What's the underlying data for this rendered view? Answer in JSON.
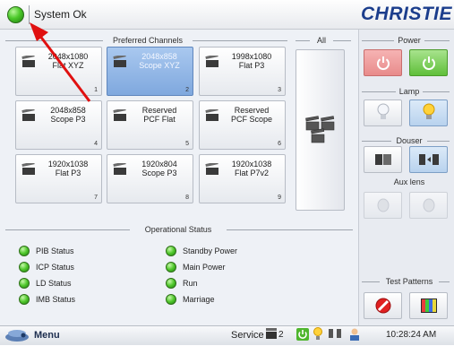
{
  "topbar": {
    "status_text": "System Ok",
    "brand": "CHRISTIE",
    "brand_color": "#1b3d8c"
  },
  "channels": {
    "title": "Preferred Channels",
    "all_title": "All",
    "tiles": [
      {
        "label": "2048x1080\nFlat XYZ",
        "num": "1",
        "selected": false
      },
      {
        "label": "2048x858\nScope XYZ",
        "num": "2",
        "selected": true
      },
      {
        "label": "1998x1080\nFlat P3",
        "num": "3",
        "selected": false
      },
      {
        "label": "2048x858\nScope P3",
        "num": "4",
        "selected": false
      },
      {
        "label": "Reserved\nPCF Flat",
        "num": "5",
        "selected": false
      },
      {
        "label": "Reserved\nPCF Scope",
        "num": "6",
        "selected": false
      },
      {
        "label": "1920x1038\nFlat P3",
        "num": "7",
        "selected": false
      },
      {
        "label": "1920x804\nScope P3",
        "num": "8",
        "selected": false
      },
      {
        "label": "1920x1038\nFlat P7v2",
        "num": "9",
        "selected": false
      }
    ]
  },
  "operational": {
    "title": "Operational Status",
    "items_left": [
      "PIB Status",
      "ICP Status",
      "LD Status",
      "IMB Status"
    ],
    "items_right": [
      "Standby Power",
      "Main Power",
      "Run",
      "Marriage"
    ]
  },
  "right": {
    "power_title": "Power",
    "lamp_title": "Lamp",
    "douser_title": "Douser",
    "aux_title": "Aux lens",
    "test_title": "Test Patterns"
  },
  "bottombar": {
    "menu_label": "Menu",
    "service_label": "Service",
    "channel_count": "2",
    "clock": "10:28:24 AM"
  },
  "colors": {
    "status_green": "#4cc92a",
    "selected_tile": "#7fa8de",
    "annotation_arrow": "#e01010"
  }
}
